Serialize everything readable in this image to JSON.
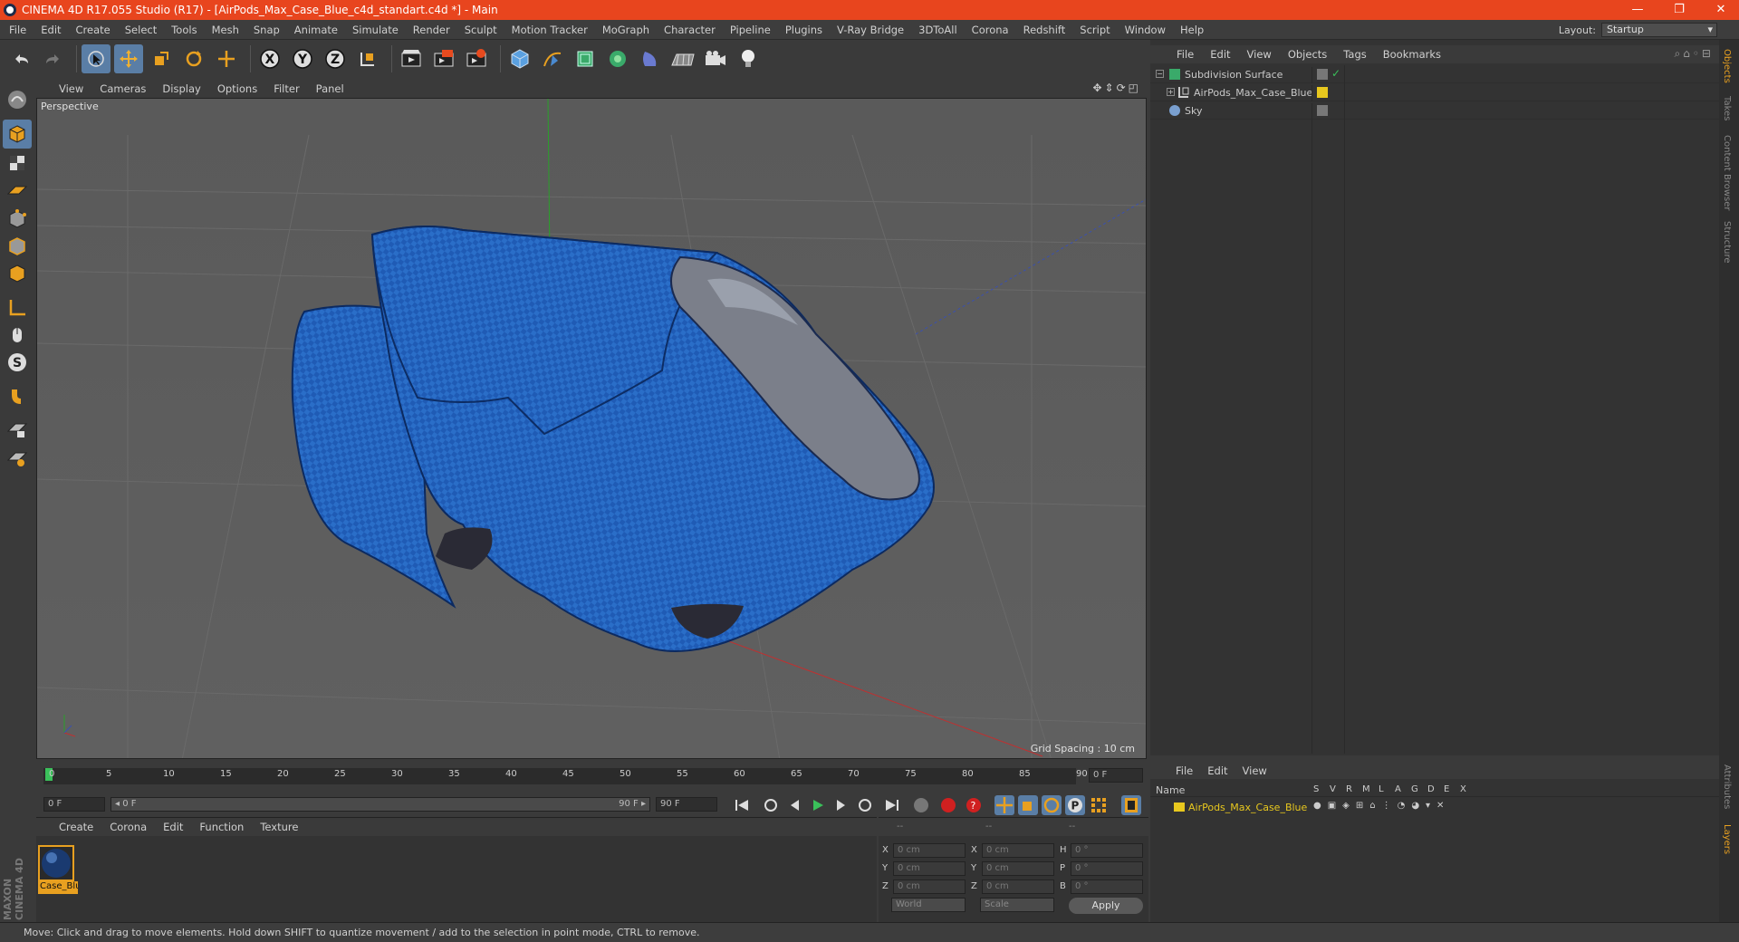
{
  "titlebar": {
    "title": "CINEMA 4D R17.055 Studio (R17) - [AirPods_Max_Case_Blue_c4d_standart.c4d *] - Main"
  },
  "menubar": {
    "items": [
      "File",
      "Edit",
      "Create",
      "Select",
      "Tools",
      "Mesh",
      "Snap",
      "Animate",
      "Simulate",
      "Render",
      "Sculpt",
      "Motion Tracker",
      "MoGraph",
      "Character",
      "Pipeline",
      "Plugins",
      "V-Ray Bridge",
      "3DToAll",
      "Corona",
      "Redshift",
      "Script",
      "Window",
      "Help"
    ],
    "layout_label": "Layout:",
    "layout_value": "Startup"
  },
  "viewport": {
    "menu": [
      "View",
      "Cameras",
      "Display",
      "Options",
      "Filter",
      "Panel"
    ],
    "label": "Perspective",
    "grid_spacing": "Grid Spacing : 10 cm"
  },
  "timeline": {
    "ticks": [
      "0",
      "5",
      "10",
      "15",
      "20",
      "25",
      "30",
      "35",
      "40",
      "45",
      "50",
      "55",
      "60",
      "65",
      "70",
      "75",
      "80",
      "85",
      "90"
    ],
    "end_frame": "0 F",
    "start_field": "0 F",
    "range_start": "◂ 0 F",
    "range_end": "90 F ▸",
    "end_field": "90 F"
  },
  "material_manager": {
    "menu": [
      "Create",
      "Corona",
      "Edit",
      "Function",
      "Texture"
    ],
    "material_name": "Case_Blu"
  },
  "coordinates": {
    "header": [
      "--",
      "--",
      "--"
    ],
    "rows": [
      {
        "a": "X",
        "av": "0 cm",
        "b": "X",
        "bv": "0 cm",
        "c": "H",
        "cv": "0 °"
      },
      {
        "a": "Y",
        "av": "0 cm",
        "b": "Y",
        "bv": "0 cm",
        "c": "P",
        "cv": "0 °"
      },
      {
        "a": "Z",
        "av": "0 cm",
        "b": "Z",
        "bv": "0 cm",
        "c": "B",
        "cv": "0 °"
      }
    ],
    "world": "World",
    "scale": "Scale",
    "apply": "Apply"
  },
  "object_manager": {
    "menu": [
      "File",
      "Edit",
      "View",
      "Objects",
      "Tags",
      "Bookmarks"
    ],
    "objects": [
      {
        "name": "Subdivision Surface"
      },
      {
        "name": "AirPods_Max_Case_Blue"
      },
      {
        "name": "Sky"
      }
    ]
  },
  "layer_manager": {
    "menu": [
      "File",
      "Edit",
      "View"
    ],
    "name_header": "Name",
    "columns": [
      "S",
      "V",
      "R",
      "M",
      "L",
      "A",
      "G",
      "D",
      "E",
      "X"
    ],
    "layer_name": "AirPods_Max_Case_Blue"
  },
  "side_tabs": [
    "Objects",
    "Takes",
    "Content Browser",
    "Structure"
  ],
  "side_tabs_bottom": [
    "Attributes",
    "Layers"
  ],
  "brand": "MAXON CINEMA 4D",
  "statusbar": {
    "text": "Move: Click and drag to move elements. Hold down SHIFT to quantize movement / add to the selection in point mode, CTRL to remove."
  },
  "colors": {
    "title_bg": "#e8451e",
    "accent": "#5a7ea6",
    "layer_yellow": "#e8c81e"
  }
}
